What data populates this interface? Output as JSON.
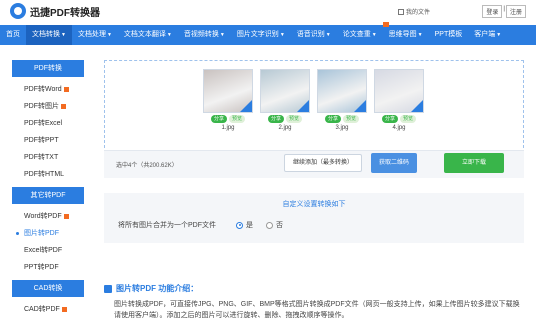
{
  "header": {
    "brand": "迅捷PDF转换器",
    "my_files": "我的文件",
    "login": "登录",
    "register": "注册",
    "auth_separator": "|"
  },
  "nav": {
    "items": [
      {
        "label": "首页",
        "has_caret": false,
        "active": false
      },
      {
        "label": "文档转换",
        "has_caret": true,
        "active": true
      },
      {
        "label": "文档处理",
        "has_caret": true,
        "active": false
      },
      {
        "label": "文档文本翻译",
        "has_caret": true,
        "active": false
      },
      {
        "label": "音视频转换",
        "has_caret": true,
        "active": false
      },
      {
        "label": "图片文字识别",
        "has_caret": true,
        "active": false
      },
      {
        "label": "语音识别",
        "has_caret": true,
        "active": false
      },
      {
        "label": "论文查重",
        "has_caret": true,
        "active": false
      },
      {
        "label": "思维导图",
        "has_caret": true,
        "active": false
      },
      {
        "label": "PPT模板",
        "has_caret": false,
        "active": false
      },
      {
        "label": "客户端",
        "has_caret": true,
        "active": false
      }
    ],
    "caret": "▼"
  },
  "sidebar": {
    "groups": [
      {
        "title": "PDF转换",
        "items": [
          {
            "label": "PDF转Word",
            "new": true
          },
          {
            "label": "PDF转图片",
            "new": true
          },
          {
            "label": "PDF转Excel",
            "new": false
          },
          {
            "label": "PDF转PPT",
            "new": false
          },
          {
            "label": "PDF转TXT",
            "new": false
          },
          {
            "label": "PDF转HTML",
            "new": false
          }
        ]
      },
      {
        "title": "其它转PDF",
        "items": [
          {
            "label": "Word转PDF",
            "new": true
          },
          {
            "label": "图片转PDF",
            "new": false,
            "active": true
          },
          {
            "label": "Excel转PDF",
            "new": false
          },
          {
            "label": "PPT转PDF",
            "new": false
          }
        ]
      },
      {
        "title": "CAD转换",
        "items": [
          {
            "label": "CAD转PDF",
            "new": true
          }
        ]
      }
    ]
  },
  "upload": {
    "files": [
      {
        "name": "1.jpg",
        "share": "分享",
        "preview": "预览",
        "tone": "#c9c2c0"
      },
      {
        "name": "2.jpg",
        "share": "分享",
        "preview": "预览",
        "tone": "#b7c9d4"
      },
      {
        "name": "3.jpg",
        "share": "分享",
        "preview": "预览",
        "tone": "#a9c4d9"
      },
      {
        "name": "4.jpg",
        "share": "分享",
        "preview": "预览",
        "tone": "#d6d9e3"
      }
    ],
    "count_text": "选中4个（共200.62K）",
    "add_button": "继续添加（最多转换）",
    "qr_button": "获取二维码",
    "download_button": "立即下载"
  },
  "settings": {
    "title": "自定义设置转换如下",
    "merge_label": "将所有图片合并为一个PDF文件",
    "option_yes": "是",
    "option_no": "否",
    "selected": "是"
  },
  "intro": {
    "title": "图片转PDF 功能介绍：",
    "text": "图片转换成PDF，可直接传JPG、PNG、GIF、BMP等格式图片转换成PDF文件（网页一般支持上传，如果上传图片较多建议下载换请使用客户端）。添加之后的图片可以进行旋转、删除、拖拽改顺序等操作。"
  },
  "colors": {
    "primary": "#2b7de0",
    "nav_active": "#1c63bf",
    "success": "#39b54a",
    "new_badge": "#f36b21"
  }
}
